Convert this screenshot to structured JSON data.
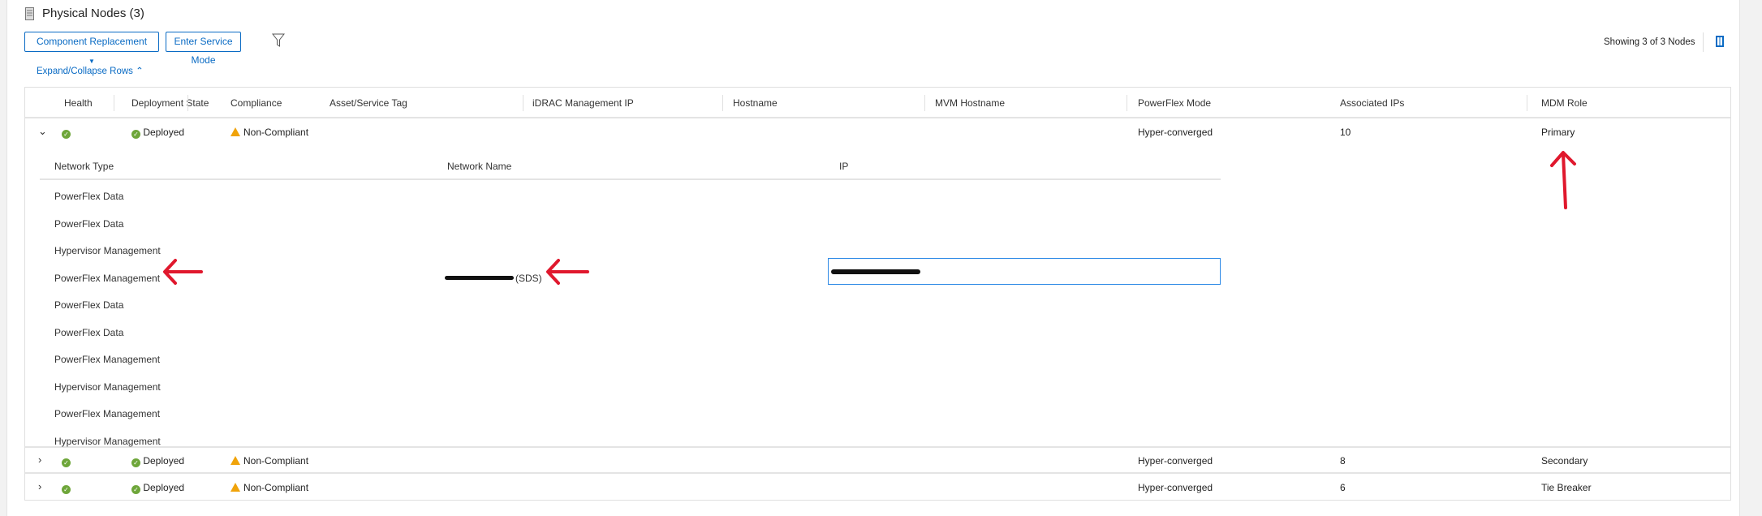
{
  "header": {
    "title": "Physical Nodes (3)",
    "showing": "Showing 3 of 3 Nodes"
  },
  "toolbar": {
    "component_replacement": "Component Replacement",
    "enter_service_mode": "Enter Service Mode",
    "expand_collapse": "Expand/Collapse Rows"
  },
  "columns": [
    "Health",
    "Deployment State",
    "Compliance",
    "Asset/Service Tag",
    "iDRAC Management IP",
    "Hostname",
    "MVM Hostname",
    "PowerFlex Mode",
    "Associated IPs",
    "MDM Role"
  ],
  "rows": [
    {
      "deployment": "Deployed",
      "compliance": "Non-Compliant",
      "mode": "Hyper-converged",
      "ips": "10",
      "mdm": "Primary"
    },
    {
      "deployment": "Deployed",
      "compliance": "Non-Compliant",
      "mode": "Hyper-converged",
      "ips": "8",
      "mdm": "Secondary"
    },
    {
      "deployment": "Deployed",
      "compliance": "Non-Compliant",
      "mode": "Hyper-converged",
      "ips": "6",
      "mdm": "Tie Breaker"
    }
  ],
  "nested": {
    "columns": [
      "Network Type",
      "Network Name",
      "IP"
    ],
    "rows": [
      "PowerFlex Data",
      "PowerFlex Data",
      "Hypervisor Management",
      "PowerFlex Management",
      "PowerFlex Data",
      "PowerFlex Data",
      "PowerFlex Management",
      "Hypervisor Management",
      "PowerFlex Management",
      "Hypervisor Management"
    ],
    "sds_suffix": "(SDS)"
  },
  "colors": {
    "accent": "#0a6bc4",
    "ok": "#6ea63a",
    "warn": "#f0a30a",
    "annotation": "#e0182d"
  }
}
